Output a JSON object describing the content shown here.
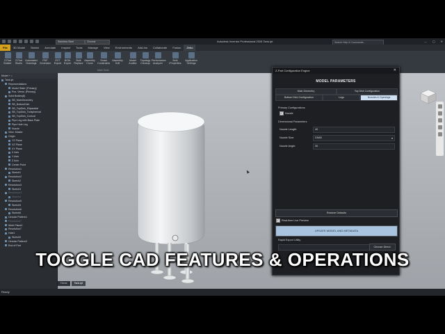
{
  "titlebar": {
    "material": "Stainless Steel",
    "appearance": "Chrome",
    "title": "Autodesk Inventor Professional 2026   Tank.ipt",
    "search": "Search Help & Commands...",
    "min": "—",
    "max": "▢",
    "close": "✕"
  },
  "menu": {
    "file": "File",
    "tabs": [
      "3D Model",
      "Sketch",
      "Annotate",
      "Inspect",
      "Tools",
      "Manage",
      "View",
      "Environments",
      "Add-Ins",
      "Collaborate",
      "Fusion",
      "Zebo"
    ],
    "active_index": 11
  },
  "ribbon": {
    "buttons": [
      "Z-Part Builder",
      "Z-Part Studio",
      "Automated Drawings",
      "PDF Generator",
      "EXT Export",
      "BOM Export",
      "Bulk Replace",
      "Assembly Clone",
      "Smart Constraints",
      "Assembly Drill",
      "Model Auditor",
      "Topology Cleanup",
      "Performance Analyzer",
      "Bulk iProperties",
      "Application Settings"
    ],
    "group_label": "Main Tools"
  },
  "browser": {
    "header": "Model",
    "items": [
      {
        "label": "Tank.ipt",
        "dim": false,
        "indent": 0
      },
      {
        "label": "Representations",
        "dim": false,
        "indent": 1
      },
      {
        "label": "Model State: [Primary]",
        "dim": false,
        "indent": 2
      },
      {
        "label": "Pos. Views: [Primary]",
        "dim": false,
        "indent": 2
      },
      {
        "label": "Solid Bodies(8)",
        "dim": false,
        "indent": 1
      },
      {
        "label": "SB_MainGeometry",
        "dim": false,
        "indent": 2
      },
      {
        "label": "SB_BottomDish",
        "dim": false,
        "indent": 2
      },
      {
        "label": "SB_TopDish_Ellipsoidal",
        "dim": false,
        "indent": 2
      },
      {
        "label": "SB_TopDish_Torispherical",
        "dim": false,
        "indent": 2
      },
      {
        "label": "SB_TopDish_Conical",
        "dim": false,
        "indent": 2
      },
      {
        "label": "Pipe Leg with Base Plate",
        "dim": false,
        "indent": 2
      },
      {
        "label": "Pipe Hole Leg",
        "dim": false,
        "indent": 2
      },
      {
        "label": "Nozzle",
        "dim": false,
        "indent": 2
      },
      {
        "label": "View: Master",
        "dim": false,
        "indent": 1
      },
      {
        "label": "Origin",
        "dim": false,
        "indent": 1
      },
      {
        "label": "YZ Plane",
        "dim": false,
        "indent": 2
      },
      {
        "label": "XZ Plane",
        "dim": false,
        "indent": 2
      },
      {
        "label": "XY Plane",
        "dim": false,
        "indent": 2
      },
      {
        "label": "X Axis",
        "dim": false,
        "indent": 2
      },
      {
        "label": "Y Axis",
        "dim": false,
        "indent": 2
      },
      {
        "label": "Z Axis",
        "dim": false,
        "indent": 2
      },
      {
        "label": "Center Point",
        "dim": false,
        "indent": 2
      },
      {
        "label": "Revolution1",
        "dim": false,
        "indent": 1
      },
      {
        "label": "Sketch1",
        "dim": false,
        "indent": 2
      },
      {
        "label": "Revolution2",
        "dim": false,
        "indent": 1
      },
      {
        "label": "Sketch2",
        "dim": false,
        "indent": 2
      },
      {
        "label": "Revolution3",
        "dim": false,
        "indent": 1
      },
      {
        "label": "Sketch3",
        "dim": false,
        "indent": 2
      },
      {
        "label": "Revolution4",
        "dim": true,
        "indent": 1
      },
      {
        "label": "Sketch4",
        "dim": true,
        "indent": 2
      },
      {
        "label": "Revolution5",
        "dim": false,
        "indent": 1
      },
      {
        "label": "Sketch5",
        "dim": false,
        "indent": 2
      },
      {
        "label": "Revolution6",
        "dim": false,
        "indent": 1
      },
      {
        "label": "Sketch6",
        "dim": false,
        "indent": 2
      },
      {
        "label": "Circular Pattern1",
        "dim": false,
        "indent": 1
      },
      {
        "label": "Revolution7",
        "dim": true,
        "indent": 1
      },
      {
        "label": "Work Plane1",
        "dim": false,
        "indent": 1
      },
      {
        "label": "Revolution7",
        "dim": false,
        "indent": 1
      },
      {
        "label": "Hole1",
        "dim": false,
        "indent": 1
      },
      {
        "label": "Sketch9",
        "dim": false,
        "indent": 2
      },
      {
        "label": "Circular Pattern3",
        "dim": false,
        "indent": 1
      },
      {
        "label": "End of Part",
        "dim": false,
        "indent": 1
      }
    ]
  },
  "doctabs": [
    "Home",
    "Tank.ipt"
  ],
  "status": "Ready",
  "dialog": {
    "title": "Z-Part Configuration Engine",
    "close": "✕",
    "heading": "MODEL PARAMETERS",
    "tabs": [
      "Main Geometry",
      "Top Dish Configuration",
      "Bottom Dish Configuration",
      "Legs",
      "Nozzles & Openings"
    ],
    "active_tab": 4,
    "primary_label": "Primary Configurations",
    "nozzle_check": "Nozzle",
    "dim_label": "Dimensional Parameters",
    "params": [
      {
        "label": "Nozzle Length:",
        "value": "40"
      },
      {
        "label": "Nozzle Size:",
        "value": "DN65"
      },
      {
        "label": "Nozzle Angle:",
        "value": "30"
      }
    ],
    "restore": "Restore Defaults",
    "realtime": "Real-time Live Preview",
    "update": "UPDATE MODEL AND METADATA",
    "export_label": "Rapid Export Utility",
    "choose": "Choose Direct."
  },
  "overlay_text": "TOGGLE CAD FEATURES & OPERATIONS",
  "colors": {
    "accent": "#d6a21c",
    "primary_button": "#a9c4de",
    "active_tab": "#cfe0f3"
  }
}
